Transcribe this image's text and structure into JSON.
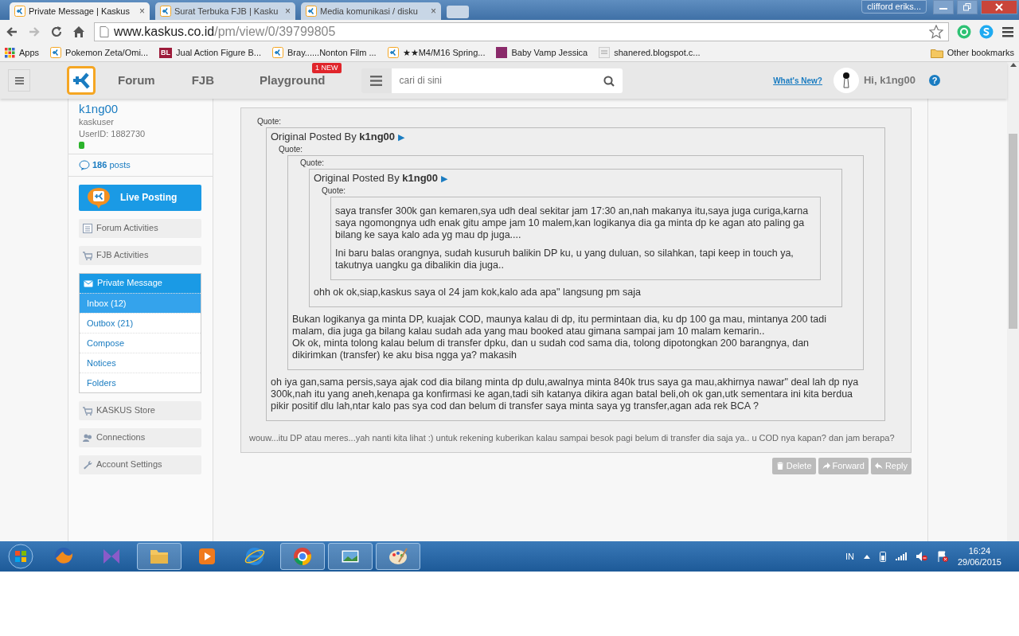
{
  "browser": {
    "tabs": [
      {
        "title": "Private Message | Kaskus",
        "close": "×",
        "selected": true
      },
      {
        "title": "Surat Terbuka FJB | Kasku",
        "close": "×",
        "selected": false
      },
      {
        "title": "Media komunikasi / disku",
        "close": "×",
        "selected": false
      }
    ],
    "profile": "clifford eriks...",
    "nav": [
      {
        "kind": "back",
        "disabled": false
      },
      {
        "kind": "forward",
        "disabled": true
      },
      {
        "kind": "reload",
        "disabled": false
      },
      {
        "kind": "home",
        "disabled": false
      }
    ],
    "url": {
      "host": "www.kaskus.co.id",
      "path": "/pm/view/0/39799805"
    },
    "bookmarks": [
      {
        "kind": "apps",
        "label": "Apps"
      },
      {
        "kind": "site",
        "label": "Pokemon Zeta/Omi..."
      },
      {
        "kind": "text",
        "favicon_text": "BL",
        "label": "Jual Action Figure B..."
      },
      {
        "kind": "site",
        "label": "Bray......Nonton Film ..."
      },
      {
        "kind": "site",
        "label": "★★M4/M16 Spring..."
      },
      {
        "kind": "square",
        "label": "Baby Vamp Jessica"
      },
      {
        "kind": "image",
        "label": "shanered.blogspot.c..."
      }
    ],
    "other_bookmarks": "Other bookmarks"
  },
  "header": {
    "nav": [
      {
        "label": "Forum"
      },
      {
        "label": "FJB"
      },
      {
        "label": "Playground",
        "badge": "1 NEW"
      }
    ],
    "search": {
      "placeholder": "cari di sini"
    },
    "whats_new": "What's New?",
    "greeting": "Hi, k1ng00",
    "help": "?"
  },
  "sidebar": {
    "username": "k1ng00",
    "rank": "kaskuser",
    "user_id": "UserID: 1882730",
    "online": true,
    "post_count": "186",
    "posts_label": "posts",
    "live_posting": "Live Posting",
    "menu": [
      {
        "kind": "forum",
        "label": "Forum Activities",
        "expanded": false
      },
      {
        "kind": "cart",
        "label": "FJB Activities",
        "expanded": false
      },
      {
        "kind": "mail",
        "label": "Private Message",
        "expanded": true,
        "children": [
          {
            "label": "Inbox (12)",
            "selected": true
          },
          {
            "label": "Outbox (21)",
            "selected": false
          },
          {
            "label": "Compose",
            "selected": false
          },
          {
            "label": "Notices",
            "selected": false
          },
          {
            "label": "Folders",
            "selected": false
          }
        ]
      },
      {
        "kind": "cart",
        "label": "KASKUS Store",
        "expanded": false
      },
      {
        "kind": "people",
        "label": "Connections",
        "expanded": false
      },
      {
        "kind": "wrench",
        "label": "Account Settings",
        "expanded": false
      }
    ]
  },
  "message": {
    "quote": {
      "label": "Quote:",
      "author_prefix": "Original Posted By",
      "author": "k1ng00",
      "arrow": "▶",
      "quote": {
        "label": "Quote:",
        "quote": {
          "label": "Quote:",
          "author_prefix": "Original Posted By",
          "author": "k1ng00",
          "arrow": "▶",
          "quote": {
            "label": "Quote:",
            "paragraphs": [
              "saya transfer 300k gan kemaren,sya udh deal sekitar jam 17:30 an,nah makanya itu,saya juga curiga,karna saya ngomongnya udh enak gitu ampe jam 10 malem,kan logikanya dia ga minta dp ke agan ato paling ga bilang ke saya kalo ada yg mau dp juga....",
              "Ini baru balas orangnya, sudah kusuruh balikin DP ku, u yang duluan, so silahkan, tapi keep in touch ya, takutnya uangku ga dibalikin dia juga.."
            ]
          },
          "paragraphs": [
            "ohh ok ok,siap,kaskus saya ol 24 jam kok,kalo ada apa\" langsung pm saja"
          ]
        },
        "paragraphs": [
          "Bukan logikanya ga minta DP, kuajak COD, maunya kalau di dp, itu permintaan dia, ku dp 100 ga mau, mintanya 200 tadi malam, dia juga ga bilang kalau sudah ada yang mau booked atau gimana sampai jam 10 malam kemarin..\nOk ok, minta tolong kalau belum di transfer dpku, dan u sudah cod sama dia, tolong dipotongkan 200 barangnya, dan dikirimkan (transfer) ke aku bisa ngga ya? makasih"
        ]
      },
      "paragraphs": [
        "oh iya gan,sama persis,saya ajak cod dia bilang minta dp dulu,awalnya minta 840k trus saya ga mau,akhirnya nawar\" deal lah dp nya 300k,nah itu yang aneh,kenapa ga konfirmasi ke agan,tadi sih katanya dikira agan batal beli,oh ok gan,utk sementara ini kita berdua pikir positif dlu lah,ntar kalo pas sya cod dan belum di transfer saya minta saya yg transfer,agan ada rek BCA ?"
      ]
    },
    "text": "wouw...itu DP atau meres...yah nanti kita lihat :) untuk rekening kuberikan kalau sampai besok pagi belum di transfer dia saja ya.. u COD nya kapan? dan jam berapa?",
    "actions": [
      {
        "kind": "delete",
        "label": "Delete"
      },
      {
        "kind": "forward",
        "label": "Forward"
      },
      {
        "kind": "reply",
        "label": "Reply"
      }
    ]
  },
  "taskbar": {
    "apps": [
      {
        "kind": "firefox",
        "open": false
      },
      {
        "kind": "vs",
        "open": false
      },
      {
        "kind": "explorer",
        "open": true
      },
      {
        "kind": "media",
        "open": false
      },
      {
        "kind": "ie",
        "open": false
      },
      {
        "kind": "chrome",
        "open": true
      },
      {
        "kind": "photo",
        "open": true
      },
      {
        "kind": "paint",
        "open": true
      }
    ],
    "language": "IN",
    "time": "16:24",
    "date": "29/06/2015"
  }
}
